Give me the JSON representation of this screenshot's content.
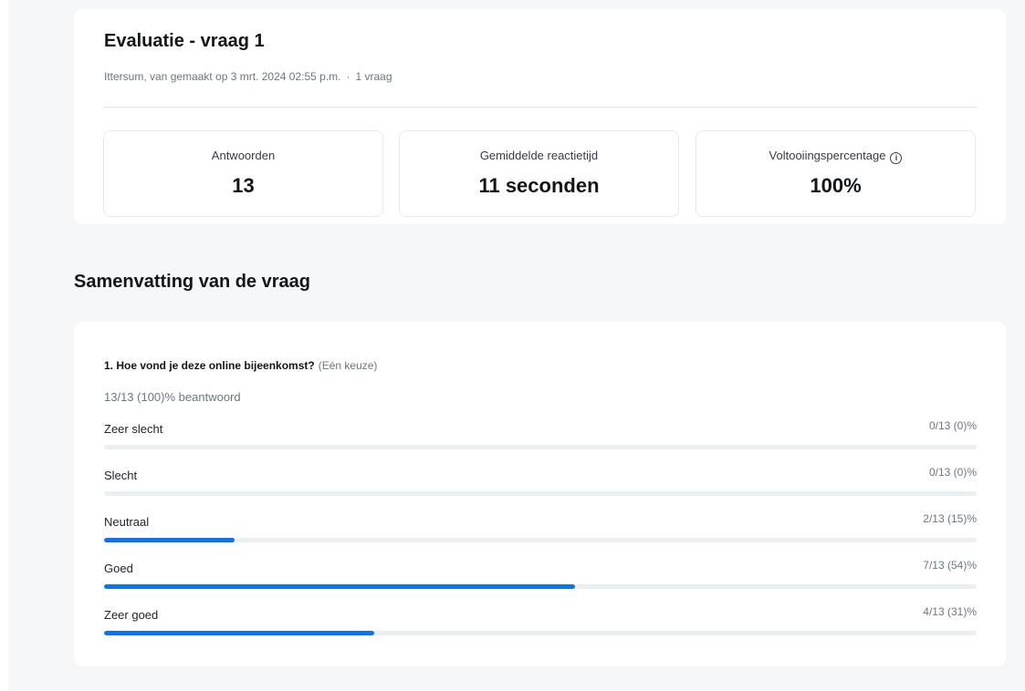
{
  "header": {
    "title": "Evaluatie - vraag 1",
    "meta_author": "Ittersum, van gemaakt op 3 mrt. 2024 02:55 p.m.",
    "meta_separator": "·",
    "meta_count": "1 vraag"
  },
  "stats": [
    {
      "label": "Antwoorden",
      "value": "13"
    },
    {
      "label": "Gemiddelde reactietijd",
      "value": "11 seconden"
    },
    {
      "label": "Voltooiingspercentage",
      "value": "100%",
      "icon": "info-icon"
    }
  ],
  "summary": {
    "section_title": "Samenvatting van de vraag",
    "question": "1. Hoe vond je deze online bijeenkomst?",
    "question_hint": "(Eén keuze)",
    "answered": "13/13 (100)% beantwoord",
    "options": [
      {
        "label": "Zeer slecht",
        "count": "0/13 (0)%",
        "fraction": 0.0
      },
      {
        "label": "Slecht",
        "count": "0/13 (0)%",
        "fraction": 0.0
      },
      {
        "label": "Neutraal",
        "count": "2/13 (15)%",
        "fraction": 0.15
      },
      {
        "label": "Goed",
        "count": "7/13 (54)%",
        "fraction": 0.54
      },
      {
        "label": "Zeer goed",
        "count": "4/13 (31)%",
        "fraction": 0.31
      }
    ]
  },
  "colors": {
    "accent": "#0e72ed",
    "track": "#eceff2",
    "background": "#f6f7f9"
  }
}
